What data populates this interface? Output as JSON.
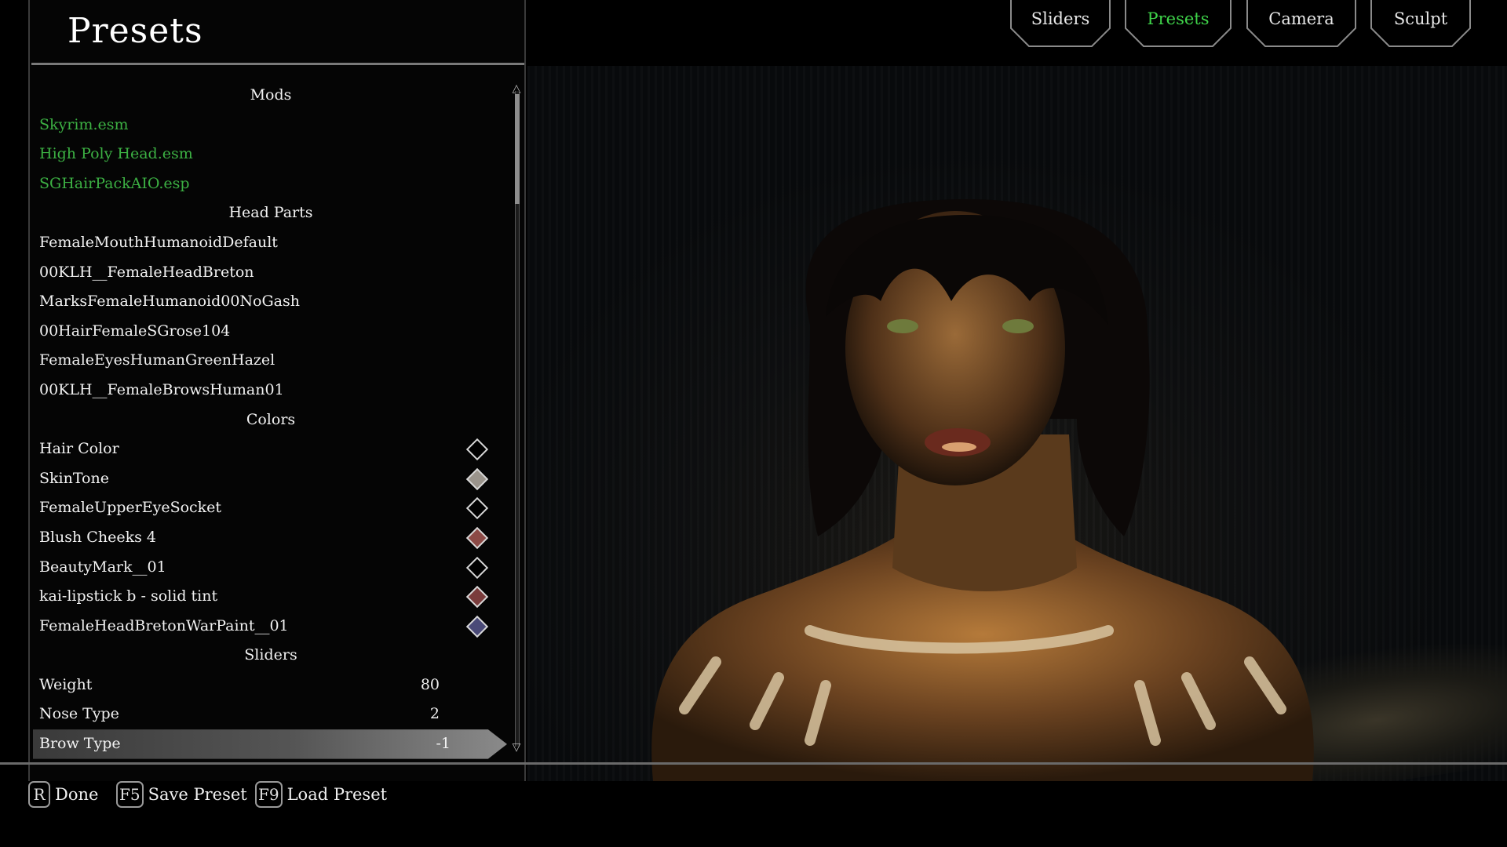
{
  "title": "Presets",
  "tabs": [
    {
      "label": "Sliders",
      "active": false
    },
    {
      "label": "Presets",
      "active": true
    },
    {
      "label": "Camera",
      "active": false
    },
    {
      "label": "Sculpt",
      "active": false
    }
  ],
  "sections": {
    "mods": {
      "header": "Mods",
      "items": [
        "Skyrim.esm",
        "High Poly Head.esm",
        "SGHairPackAIO.esp"
      ]
    },
    "head_parts": {
      "header": "Head Parts",
      "items": [
        "FemaleMouthHumanoidDefault",
        "00KLH__FemaleHeadBreton",
        "MarksFemaleHumanoid00NoGash",
        "00HairFemaleSGrose104",
        "FemaleEyesHumanGreenHazel",
        "00KLH__FemaleBrowsHuman01"
      ]
    },
    "colors": {
      "header": "Colors",
      "items": [
        {
          "label": "Hair Color",
          "color": "#000000"
        },
        {
          "label": "SkinTone",
          "color": "#9a948c"
        },
        {
          "label": "FemaleUpperEyeSocket",
          "color": "#000000"
        },
        {
          "label": "Blush Cheeks 4",
          "color": "#8c4a46"
        },
        {
          "label": "BeautyMark__01",
          "color": "#000000"
        },
        {
          "label": "kai-lipstick b - solid tint",
          "color": "#7a3c3c"
        },
        {
          "label": "FemaleHeadBretonWarPaint__01",
          "color": "#4a4a78"
        }
      ]
    },
    "sliders": {
      "header": "Sliders",
      "items": [
        {
          "label": "Weight",
          "value": "80"
        },
        {
          "label": "Nose Type",
          "value": "2"
        },
        {
          "label": "Brow Type",
          "value": "-1",
          "selected": true
        }
      ]
    }
  },
  "bottom_hints": [
    {
      "key": "R",
      "label": "Done"
    },
    {
      "key": "F5",
      "label": "Save Preset"
    },
    {
      "key": "F9",
      "label": "Load Preset"
    }
  ],
  "colors": {
    "active_tab": "#3fd44a",
    "mod_text": "#3cb043",
    "panel_bg": "#050505"
  }
}
